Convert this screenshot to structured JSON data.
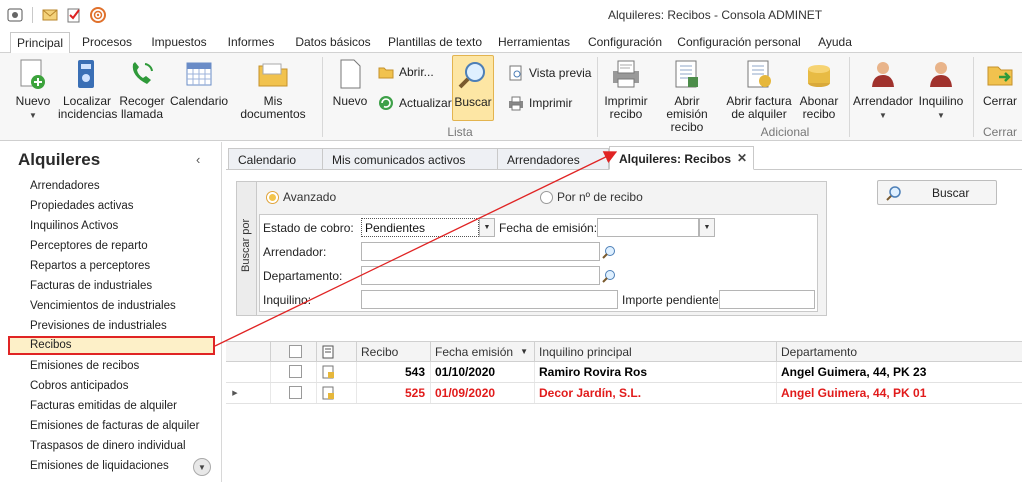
{
  "window": {
    "title": "Alquileres: Recibos - Consola ADMINET"
  },
  "quick_access": [
    "app-icon",
    "mail-icon",
    "task-icon",
    "rss-icon"
  ],
  "menu_tabs": [
    "Principal",
    "Procesos",
    "Impuestos",
    "Informes",
    "Datos básicos",
    "Plantillas de texto",
    "Herramientas",
    "Configuración",
    "Configuración personal",
    "Ayuda"
  ],
  "ribbon": {
    "nuevo": "Nuevo",
    "localizar": [
      "Localizar",
      "incidencias"
    ],
    "recoger": [
      "Recoger",
      "llamada"
    ],
    "calendario": "Calendario",
    "mis_documentos": "Mis documentos",
    "nuevo2": "Nuevo",
    "abrir": "Abrir...",
    "actualizar": "Actualizar",
    "buscar": "Buscar",
    "vista_previa": "Vista previa",
    "imprimir": "Imprimir",
    "group_lista": "Lista",
    "imprimir_recibo": [
      "Imprimir",
      "recibo"
    ],
    "abrir_emision": [
      "Abrir emisión",
      "recibo"
    ],
    "abrir_factura": [
      "Abrir factura",
      "de alquiler"
    ],
    "abonar": [
      "Abonar",
      "recibo"
    ],
    "group_adicional": "Adicional",
    "arrendador": "Arrendador",
    "inquilino": "Inquilino",
    "cerrar": "Cerrar",
    "group_cerrar": "Cerrar"
  },
  "sidebar": {
    "title": "Alquileres",
    "items": [
      "Arrendadores",
      "Propiedades activas",
      "Inquilinos Activos",
      "Perceptores de reparto",
      "Repartos a perceptores",
      "Facturas de industriales",
      "Vencimientos de industriales",
      "Previsiones de industriales",
      "Recibos",
      "Emisiones de recibos",
      "Cobros anticipados",
      "Facturas emitidas de alquiler",
      "Emisiones de facturas de alquiler",
      "Traspasos de dinero individual",
      "Emisiones de liquidaciones"
    ],
    "selected_index": 8
  },
  "doc_tabs": [
    "Calendario",
    "Mis comunicados activos",
    "Arrendadores",
    "Alquileres: Recibos"
  ],
  "search": {
    "side_label": "Buscar por",
    "radio_advanced": "Avanzado",
    "radio_receipt": "Por nº de recibo",
    "estado_label": "Estado de cobro:",
    "estado_value": "Pendientes",
    "fecha_label": "Fecha de emisión:",
    "fecha_value": "",
    "arrendador_label": "Arrendador:",
    "arrendador_value": "",
    "departamento_label": "Departamento:",
    "departamento_value": "",
    "inquilino_label": "Inquilino:",
    "inquilino_value": "",
    "importe_label": "Importe pendiente:",
    "importe_value": "",
    "button": "Buscar"
  },
  "grid": {
    "columns": [
      "Recibo",
      "Fecha emisión",
      "Inquilino principal",
      "Departamento"
    ],
    "rows": [
      {
        "recibo": "543",
        "fecha": "01/10/2020",
        "inquilino": "Ramiro Rovira Ros",
        "departamento": "Angel Guimera, 44, PK 23",
        "color": "#000000"
      },
      {
        "recibo": "525",
        "fecha": "01/09/2020",
        "inquilino": "Decor Jardín, S.L.",
        "departamento": "Angel Guimera, 44, PK 01",
        "color": "#e11b1b"
      }
    ]
  },
  "colors": {
    "highlight_border": "#e02424",
    "selected_bg": "#fdf0c8",
    "accent_button": "#fde6a4"
  }
}
